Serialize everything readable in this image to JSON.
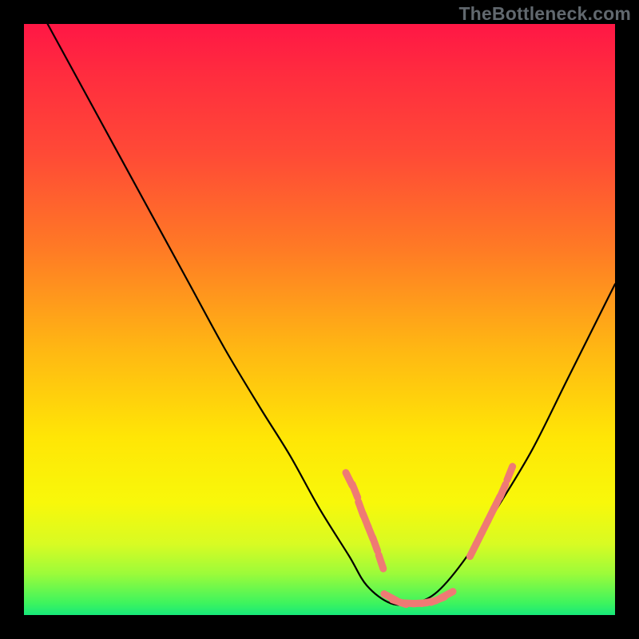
{
  "watermark": "TheBottleneck.com",
  "chart_data": {
    "type": "line",
    "title": "",
    "xlabel": "",
    "ylabel": "",
    "xlim": [
      0,
      100
    ],
    "ylim": [
      0,
      100
    ],
    "grid": false,
    "legend": false,
    "series": [
      {
        "name": "bottleneck-curve",
        "x": [
          4,
          10,
          16,
          22,
          28,
          34,
          40,
          45,
          50,
          55,
          58,
          62,
          66,
          70,
          75,
          80,
          86,
          92,
          100
        ],
        "y": [
          100,
          89,
          78,
          67,
          56,
          45,
          35,
          27,
          18,
          10,
          5,
          2,
          2,
          4,
          10,
          18,
          28,
          40,
          56
        ],
        "color": "#000000"
      }
    ],
    "markers": [
      {
        "name": "highlight-dashes-left",
        "color": "#ef7a74",
        "points": [
          {
            "x": 55,
            "y": 23
          },
          {
            "x": 56,
            "y": 21
          },
          {
            "x": 57,
            "y": 18
          },
          {
            "x": 57.8,
            "y": 16
          },
          {
            "x": 58.6,
            "y": 14
          },
          {
            "x": 59.4,
            "y": 12
          },
          {
            "x": 60.4,
            "y": 9
          }
        ]
      },
      {
        "name": "highlight-dashes-bottom",
        "color": "#ef7a74",
        "points": [
          {
            "x": 62,
            "y": 3
          },
          {
            "x": 63.5,
            "y": 2.2
          },
          {
            "x": 65,
            "y": 2
          },
          {
            "x": 67,
            "y": 2
          },
          {
            "x": 68.5,
            "y": 2.2
          },
          {
            "x": 70,
            "y": 2.6
          },
          {
            "x": 71.5,
            "y": 3.4
          }
        ]
      },
      {
        "name": "highlight-dashes-right",
        "color": "#ef7a74",
        "points": [
          {
            "x": 76,
            "y": 11
          },
          {
            "x": 77,
            "y": 13
          },
          {
            "x": 78,
            "y": 15
          },
          {
            "x": 79,
            "y": 17
          },
          {
            "x": 80,
            "y": 19
          },
          {
            "x": 81,
            "y": 21
          },
          {
            "x": 82.2,
            "y": 24
          }
        ]
      }
    ]
  }
}
